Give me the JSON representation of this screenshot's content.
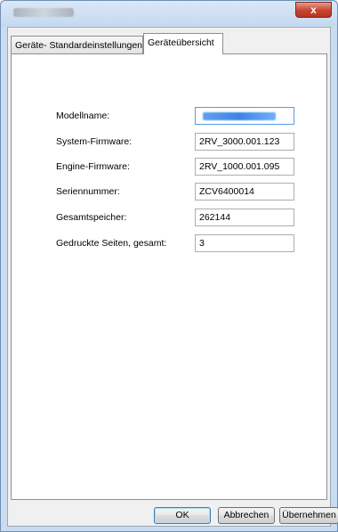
{
  "window": {
    "title": "",
    "close_label": "x"
  },
  "tabs": [
    {
      "label": "Geräte- Standardeinstellungen",
      "active": false
    },
    {
      "label": "Geräteübersicht",
      "active": true
    }
  ],
  "fields": [
    {
      "label": "Modellname:",
      "value": ""
    },
    {
      "label": "System-Firmware:",
      "value": "2RV_3000.001.123"
    },
    {
      "label": "Engine-Firmware:",
      "value": "2RV_1000.001.095"
    },
    {
      "label": "Seriennummer:",
      "value": "ZCV6400014"
    },
    {
      "label": "Gesamtspeicher:",
      "value": "262144"
    },
    {
      "label": "Gedruckte Seiten, gesamt:",
      "value": "3"
    }
  ],
  "buttons": {
    "ok": "OK",
    "cancel": "Abbrechen",
    "apply": "Übernehmen"
  }
}
